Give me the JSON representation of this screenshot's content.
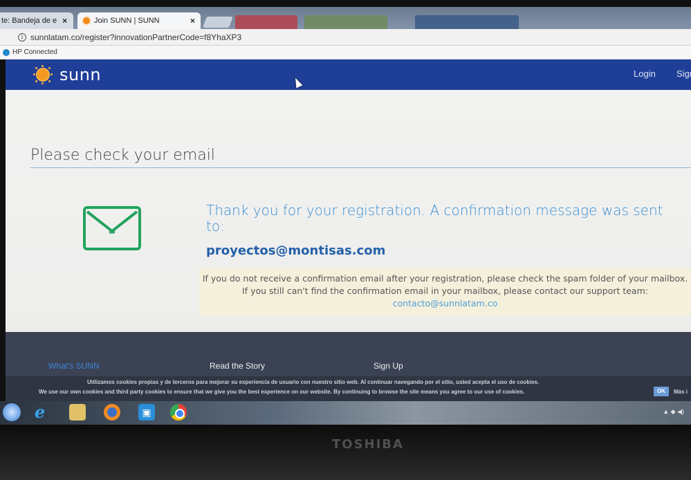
{
  "browser": {
    "tabs": [
      {
        "label": "te: Bandeja de e"
      },
      {
        "label": "Join SUNN | SUNN"
      }
    ],
    "url": "sunnlatam.co/register?innovationPartnerCode=f8YhaXP3",
    "bookmark": "HP Connected"
  },
  "header": {
    "brand": "sunn",
    "login": "Login",
    "signup": "Sign"
  },
  "main": {
    "title": "Please check your email",
    "thanks": "Thank you for your registration. A confirmation message was sent to:",
    "email": "proyectos@montisas.com",
    "notice_text": "If you do not receive a confirmation email after your registration, please check the spam folder of your mailbox. If you still can't find the confirmation email in your mailbox, please contact our support team:",
    "support_email": "contacto@sunnlatam.co"
  },
  "footer": {
    "links": [
      "What's SUNN",
      "Read the Story",
      "Sign Up"
    ]
  },
  "cookies": {
    "es": "Utilizamos cookies propias y de terceros para mejorar su experiencia de usuario con nuestro sitio web. Al continuar navegando por el sitio, usted acepta el uso de cookies.",
    "en": "We use our own cookies and third party cookies to ensure that we give you the best experience on our website. By continuing to browse the site means you agree to our use of cookies.",
    "ok": "OK",
    "more": "Más i"
  },
  "device": {
    "maker": "TOSHIBA"
  },
  "colors": {
    "header_bg": "#1f3e98",
    "accent_orange": "#f29a1f",
    "heading_blue": "#3b8fd3",
    "email_blue": "#2360a8",
    "mail_icon_green": "#23a35e",
    "footer_bg": "#3a4254"
  },
  "icons": [
    "info-icon",
    "sun-logo-icon",
    "mail-icon",
    "cursor-icon",
    "ie-icon",
    "explorer-icon",
    "firefox-icon",
    "store-icon",
    "chrome-icon"
  ]
}
